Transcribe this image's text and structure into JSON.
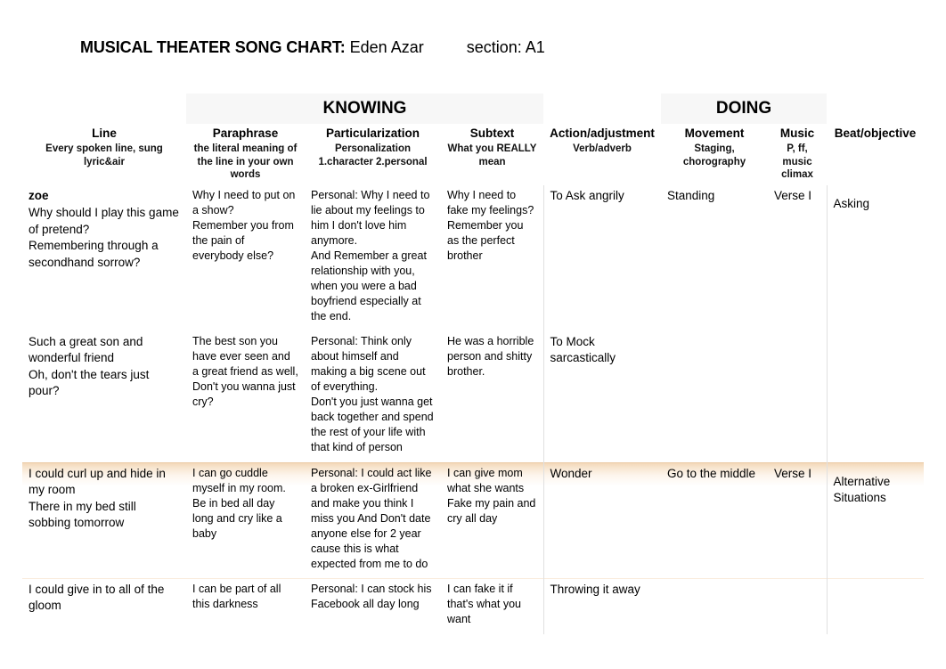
{
  "title": {
    "label": "MUSICAL THEATER SONG CHART:",
    "student": "Eden Azar",
    "section": "section: A1"
  },
  "bands": {
    "knowing": "KNOWING",
    "doing": "DOING"
  },
  "columns": [
    {
      "title": "Line",
      "sub": "Every spoken line, sung lyric&air"
    },
    {
      "title": "Paraphrase",
      "sub": "the literal meaning of the line in your own words"
    },
    {
      "title": "Particularization",
      "sub": "Personalization\n1.character  2.personal"
    },
    {
      "title": "Subtext",
      "sub": "What you REALLY mean"
    },
    {
      "title": "Action/adjustment",
      "sub": "Verb/adverb"
    },
    {
      "title": "Movement",
      "sub": "Staging, chorography"
    },
    {
      "title": "Music",
      "sub": "P, ff, music climax"
    },
    {
      "title": "Beat/objective",
      "sub": ""
    }
  ],
  "rows": [
    {
      "highlighted": false,
      "speaker": "zoe",
      "line": "Why should I play this game of pretend?\nRemembering through a secondhand sorrow?",
      "paraphrase": "Why I need to put on a show?\nRemember you from the pain of everybody else?",
      "particularization": "Personal: Why I need to lie about my feelings to him I don't love him anymore.\nAnd Remember a great relationship with you, when you were a bad boyfriend especially at the end.",
      "subtext": "Why I need to fake my feelings?\nRemember you as the perfect brother",
      "action": "To Ask angrily",
      "movement": "Standing",
      "music": "Verse I",
      "beat": "Asking"
    },
    {
      "highlighted": false,
      "speaker": "",
      "line": "Such a great son and wonderful friend\nOh, don't the tears just pour?",
      "paraphrase": "The best son you have ever seen and a great friend as well, Don't you wanna just cry?",
      "particularization": "Personal: Think only about himself and making a big scene out of everything.\nDon't you just wanna get back together and spend the rest of your life with that kind of person",
      "subtext": "He was a horrible person and shitty brother.",
      "action": "To Mock sarcastically",
      "movement": "",
      "music": "",
      "beat": ""
    },
    {
      "highlighted": true,
      "speaker": "",
      "line": "I could curl up and hide in my room\nThere in my bed still sobbing tomorrow",
      "paraphrase": "I can go cuddle myself in my room.\nBe in bed all day long and cry like a baby",
      "particularization": "Personal: I could act like a broken ex-Girlfriend and make you think I miss you And Don't date anyone else for 2 year cause this is what expected from me to do",
      "subtext": "I can give mom what she wants Fake my pain and cry all day",
      "action": "Wonder",
      "movement": "Go to the middle",
      "music": "Verse I",
      "beat": "Alternative Situations"
    },
    {
      "highlighted": false,
      "speaker": "",
      "line": "I could give in to all of the gloom",
      "paraphrase": "I can be part of all this darkness",
      "particularization": "Personal: I can stock his Facebook all day long",
      "subtext": " I can fake it if that's what you want",
      "action": "Throwing it away",
      "movement": "",
      "music": "",
      "beat": ""
    }
  ],
  "colors": {
    "highlight": "#f3d7b8",
    "band_bg": "#f7f7f7",
    "rule": "#e3e3e3"
  }
}
